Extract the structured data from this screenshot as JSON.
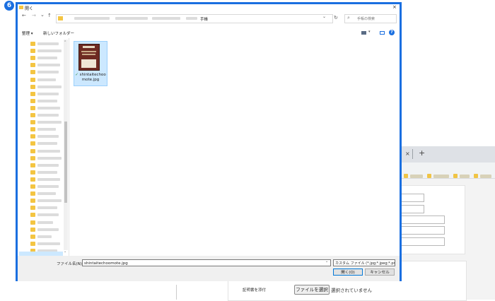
{
  "step_badge": "6",
  "background": {
    "tab_close": "×",
    "tab_new": "+",
    "file_button": "ファイルを選択",
    "file_status": "選択されていません",
    "row_label": "証明書を添付"
  },
  "dialog": {
    "title": "開く",
    "close": "×",
    "nav_back": "←",
    "nav_forward": "→",
    "nav_recent": "⌄",
    "nav_up": "↑",
    "address_tail": "手帳",
    "address_dropdown": "⌄",
    "refresh": "↻",
    "search_placeholder": "手帳の検索",
    "search_icon": "⌕",
    "organize_label": "整理 ▾",
    "new_folder_label": "新しいフォルダー",
    "help": "?",
    "file": {
      "name": "shintaitechoomote.jpg",
      "name_line1": "shintaitechoo",
      "name_line2": "mote.jpg",
      "sync_icon": "✓"
    },
    "filename_label": "ファイル名(N):",
    "filename_value": "shintaitechoomote.jpg",
    "filter_value": "カスタム ファイル (*.jpg;*.jpeg;*.pn",
    "open_button": "開く(O)",
    "cancel_button": "キャンセル"
  }
}
